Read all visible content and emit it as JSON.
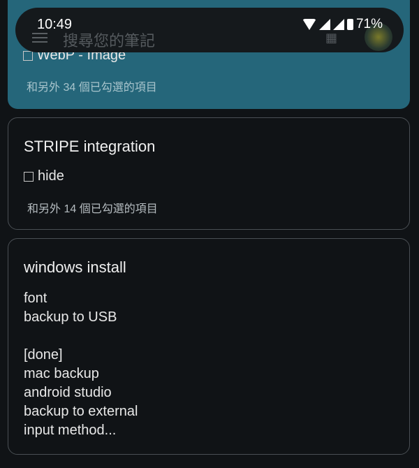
{
  "status_bar": {
    "time": "10:49",
    "battery": "71%",
    "icons": [
      "wifi-icon",
      "signal-icon",
      "signal-icon",
      "battery-icon"
    ]
  },
  "search": {
    "placeholder": "搜尋您的筆記"
  },
  "notes": [
    {
      "items": [
        "WebP - Image"
      ],
      "more": "和另外 34 個已勾選的項目",
      "color": "#25667a"
    },
    {
      "title": "STRIPE integration",
      "items": [
        "hide"
      ],
      "more": "和另外 14 個已勾選的項目"
    },
    {
      "title": "windows install",
      "body": "font\nbackup to USB\n\n[done]\nmac backup\nandroid studio\nbackup to external\ninput method..."
    }
  ]
}
